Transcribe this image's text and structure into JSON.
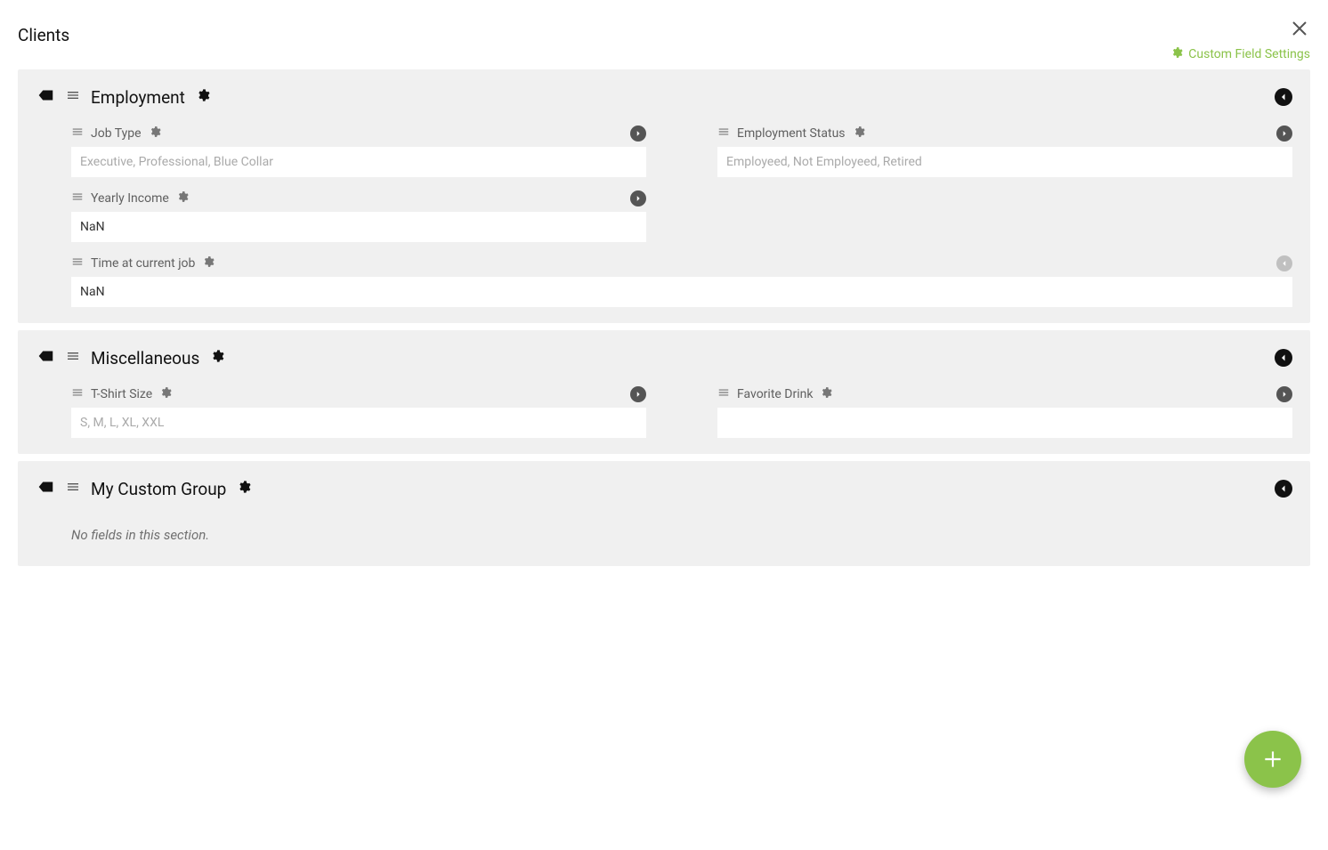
{
  "page_title": "Clients",
  "settings_link": "Custom Field Settings",
  "no_fields_text": "No fields in this section.",
  "groups": [
    {
      "title": "Employment",
      "fields": [
        {
          "label": "Job Type",
          "placeholder": "Executive, Professional, Blue Collar",
          "value": "",
          "width": "half",
          "expand_style": "dark"
        },
        {
          "label": "Employment Status",
          "placeholder": "Employeed, Not Employeed, Retired",
          "value": "",
          "width": "half",
          "expand_style": "dark"
        },
        {
          "label": "Yearly Income",
          "placeholder": "",
          "value": "NaN",
          "width": "half",
          "expand_style": "dark"
        },
        {
          "label": "Time at current job",
          "placeholder": "",
          "value": "NaN",
          "width": "full",
          "expand_style": "light"
        }
      ]
    },
    {
      "title": "Miscellaneous",
      "fields": [
        {
          "label": "T-Shirt Size",
          "placeholder": "S, M, L, XL, XXL",
          "value": "",
          "width": "half",
          "expand_style": "dark"
        },
        {
          "label": "Favorite Drink",
          "placeholder": "",
          "value": "",
          "width": "half",
          "expand_style": "dark"
        }
      ]
    },
    {
      "title": "My Custom Group",
      "fields": []
    }
  ]
}
